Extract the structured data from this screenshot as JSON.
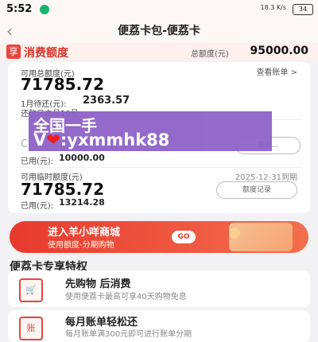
{
  "status_bar": {
    "time": "5:52",
    "network": "18.3 K/s",
    "battery": "34"
  },
  "header": {
    "back_icon": "chevron-left-icon",
    "title": "便荔卡包-便荔卡"
  },
  "top_band": {
    "brand": "消费额度",
    "total_label": "总额度(元)",
    "total_value": "95000.00"
  },
  "card": {
    "available_label": "可用总额度(元)",
    "available_value": "71785.72",
    "view_bill": "查看账单 >",
    "due_label": "1月待还(元):",
    "due_value": "2363.57",
    "due_date": "还款日本月10号",
    "fixed_hidden_label": "C",
    "used_label": "已用(元):",
    "used_value": "10000.00",
    "temp_label": "可用临时额度(元)",
    "temp_expiry": "2025-12-31到期",
    "temp_value": "71785.72",
    "temp_record": "额度记录",
    "temp_used_label": "已用(元):",
    "temp_used_value": "13214.28",
    "action_pill": "额度..."
  },
  "watermark": {
    "line1": "全国一手",
    "line2_prefix": "V",
    "line2_heart": "❤",
    "line2_suffix": ":yxmmhk88"
  },
  "banner": {
    "title": "进入羊小咩商城",
    "subtitle": "使用额度-分期购物",
    "go": "GO"
  },
  "section": {
    "title": "便荔卡专享特权",
    "rows": [
      {
        "icon": "cart-icon",
        "title": "先购物 后消费",
        "subtitle": "使用便荔卡最高可享40天购物免息"
      },
      {
        "icon": "bill-icon",
        "title": "每月账单轻松还",
        "subtitle": "每月账单满300元即可进行账单分期"
      }
    ]
  }
}
